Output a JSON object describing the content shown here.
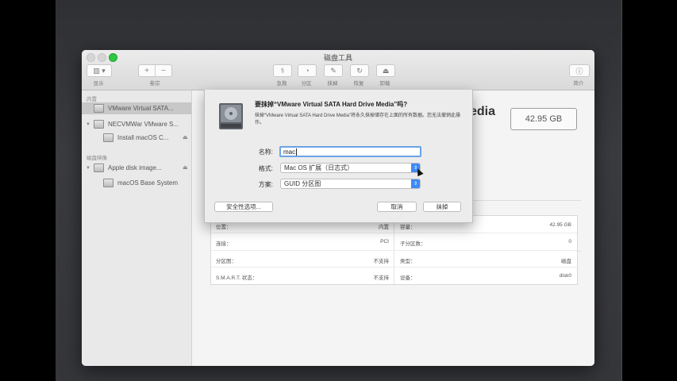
{
  "window": {
    "title": "磁盘工具"
  },
  "toolbar": {
    "view_label": "显示",
    "volume_label": "卷宗",
    "rescue_label": "急救",
    "partition_label": "分区",
    "erase_label": "抹掉",
    "restore_label": "恢复",
    "unmount_label": "卸载",
    "info_label": "简介"
  },
  "sidebar": {
    "internal_header": "内置",
    "image_header": "磁盘映像",
    "items": [
      {
        "label": "VMware Virtual SATA..."
      },
      {
        "label": "NECVMWar VMware S..."
      },
      {
        "label": "Install macOS C..."
      },
      {
        "label": "Apple disk image..."
      },
      {
        "label": "macOS Base System"
      }
    ]
  },
  "main": {
    "title_fragment": "edia",
    "capacity": "42.95 GB"
  },
  "info_table": {
    "rows": [
      {
        "l_label": "位置：",
        "l_value": "内置",
        "r_label": "容量：",
        "r_value": "42.95 GB"
      },
      {
        "l_label": "连接：",
        "l_value": "PCI",
        "r_label": "子分区数：",
        "r_value": "0"
      },
      {
        "l_label": "分区图：",
        "l_value": "不支持",
        "r_label": "类型：",
        "r_value": "磁盘"
      },
      {
        "l_label": "S.M.A.R.T. 状态：",
        "l_value": "不支持",
        "r_label": "设备：",
        "r_value": "disk0"
      }
    ]
  },
  "sheet": {
    "title": "要抹掉“VMware Virtual SATA Hard Drive Media”吗?",
    "description": "抹掉“VMware Virtual SATA Hard Drive Media”将永久抹掉储存在上面的所有数据。您无法撤销此操作。",
    "name_label": "名称:",
    "name_value": "mac",
    "format_label": "格式:",
    "format_value": "Mac OS 扩展（日志式）",
    "scheme_label": "方案:",
    "scheme_value": "GUID 分区图",
    "security_button": "安全性选项...",
    "cancel_button": "取消",
    "erase_button": "抹掉"
  },
  "colors": {
    "accent": "#3d8af7",
    "focus_ring": "#6aa3e8",
    "maximize": "#2ec840"
  }
}
